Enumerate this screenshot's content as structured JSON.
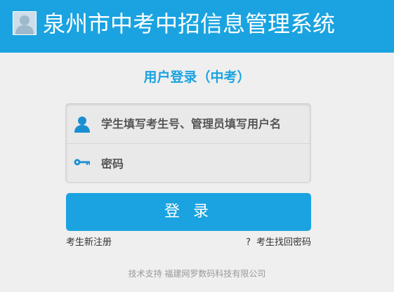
{
  "header": {
    "title": "泉州市中考中招信息管理系统",
    "logo_icon": "user-avatar-icon"
  },
  "login": {
    "title": "用户登录（中考）",
    "username_placeholder": "学生填写考生号、管理员填写用户名",
    "password_placeholder": "密码",
    "username_icon": "user-icon",
    "password_icon": "key-icon",
    "submit_label": "登 录"
  },
  "links": {
    "register": "考生新注册",
    "forgot_prefix": "?",
    "forgot": "考生找回密码"
  },
  "footer": {
    "support": "技术支持 福建网罗数码科技有限公司"
  },
  "colors": {
    "accent": "#1aa3e0",
    "background": "#efefef"
  }
}
